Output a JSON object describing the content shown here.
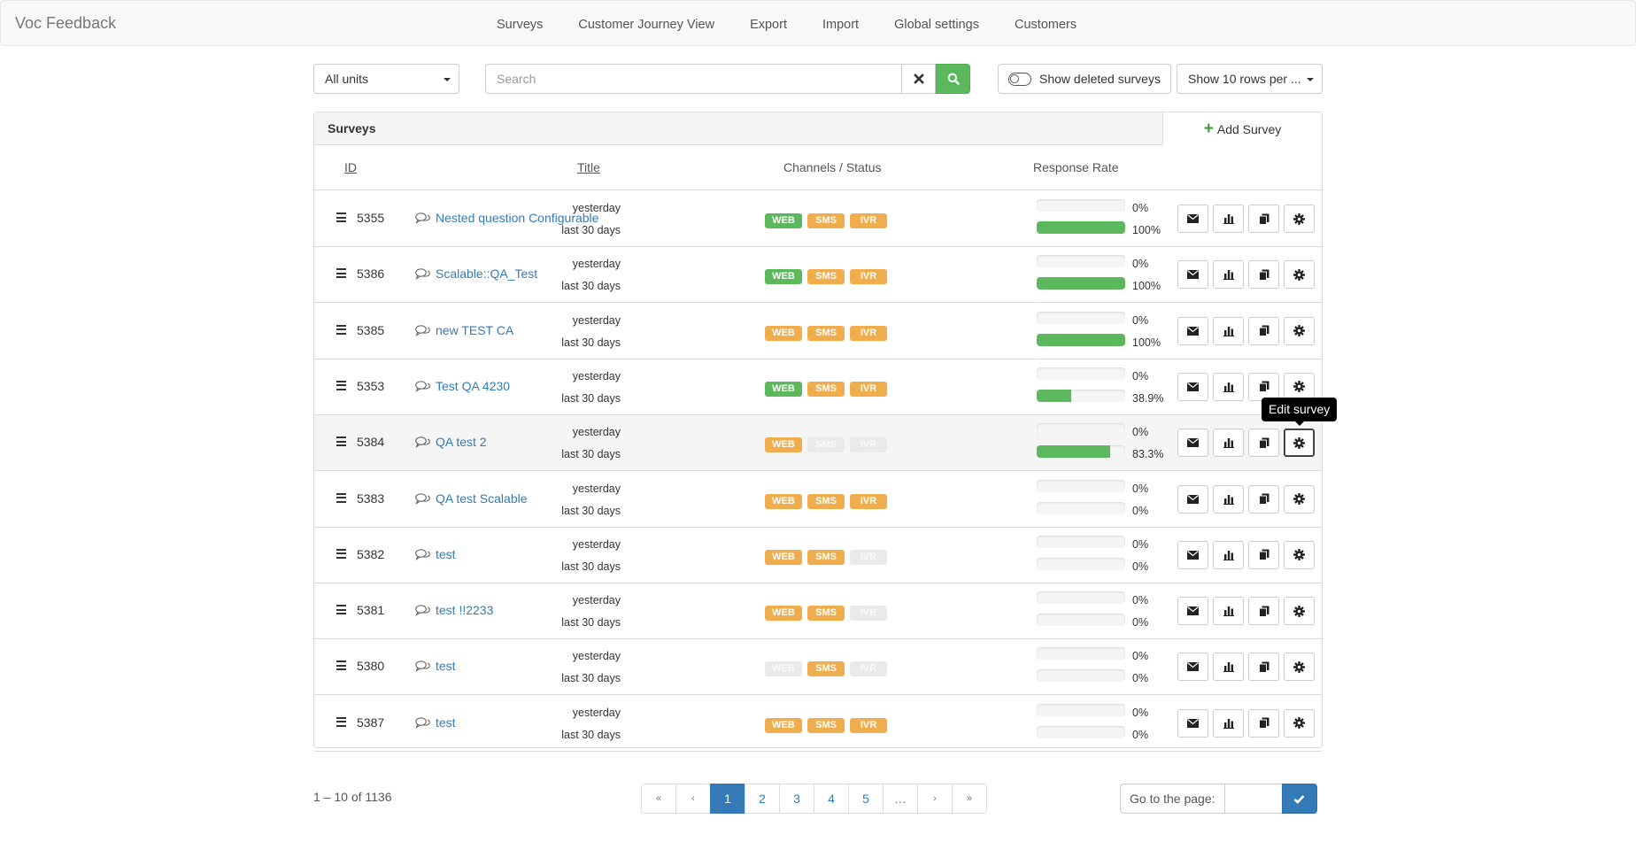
{
  "navbar": {
    "brand": "Voc Feedback",
    "links": [
      "Surveys",
      "Customer Journey View",
      "Export",
      "Import",
      "Global settings",
      "Customers"
    ]
  },
  "toolbar": {
    "units_value": "All units",
    "search_placeholder": "Search",
    "show_deleted_label": "Show deleted surveys",
    "show_deleted_on": false,
    "rows_per_page_label": "Show 10 rows per ..."
  },
  "panel": {
    "title": "Surveys",
    "add_label": "Add Survey",
    "columns": {
      "id": "ID",
      "title": "Title",
      "channels": "Channels / Status",
      "response": "Response Rate"
    }
  },
  "response_labels": {
    "yesterday": "yesterday",
    "last30": "last 30 days"
  },
  "channel_names": [
    "WEB",
    "SMS",
    "IVR"
  ],
  "colors": {
    "active_web": "#5cb85c",
    "active_channel": "#f0ad4e",
    "inactive": "#eaeaea",
    "progress": "#5cb85c",
    "link": "#337ab7"
  },
  "rows": [
    {
      "id": "5355",
      "title": "Nested question Configurable",
      "channels": [
        "green",
        "orange",
        "orange"
      ],
      "yesterday": "0%",
      "yesterday_value": 0,
      "last30": "100%",
      "last30_value": 100
    },
    {
      "id": "5386",
      "title": "Scalable::QA_Test",
      "channels": [
        "green",
        "orange",
        "orange"
      ],
      "yesterday": "0%",
      "yesterday_value": 0,
      "last30": "100%",
      "last30_value": 100
    },
    {
      "id": "5385",
      "title": "new TEST CA",
      "channels": [
        "orange",
        "orange",
        "orange"
      ],
      "yesterday": "0%",
      "yesterday_value": 0,
      "last30": "100%",
      "last30_value": 100
    },
    {
      "id": "5353",
      "title": "Test QA 4230",
      "channels": [
        "green",
        "orange",
        "orange"
      ],
      "yesterday": "0%",
      "yesterday_value": 0,
      "last30": "38.9%",
      "last30_value": 38.9
    },
    {
      "id": "5384",
      "title": "QA test 2",
      "channels": [
        "orange",
        "gray",
        "gray"
      ],
      "yesterday": "0%",
      "yesterday_value": 0,
      "last30": "83.3%",
      "last30_value": 83.3
    },
    {
      "id": "5383",
      "title": "QA test Scalable",
      "channels": [
        "orange",
        "orange",
        "orange"
      ],
      "yesterday": "0%",
      "yesterday_value": 0,
      "last30": "0%",
      "last30_value": 0
    },
    {
      "id": "5382",
      "title": "test",
      "channels": [
        "orange",
        "orange",
        "gray"
      ],
      "yesterday": "0%",
      "yesterday_value": 0,
      "last30": "0%",
      "last30_value": 0
    },
    {
      "id": "5381",
      "title": "test !!2233",
      "channels": [
        "orange",
        "orange",
        "gray"
      ],
      "yesterday": "0%",
      "yesterday_value": 0,
      "last30": "0%",
      "last30_value": 0
    },
    {
      "id": "5380",
      "title": "test",
      "channels": [
        "gray",
        "orange",
        "gray"
      ],
      "yesterday": "0%",
      "yesterday_value": 0,
      "last30": "0%",
      "last30_value": 0
    },
    {
      "id": "5387",
      "title": "test",
      "channels": [
        "orange",
        "orange",
        "orange"
      ],
      "yesterday": "0%",
      "yesterday_value": 0,
      "last30": "0%",
      "last30_value": 0
    }
  ],
  "row_actions": [
    "envelope-icon",
    "bar-chart-icon",
    "copy-icon",
    "gear-icon"
  ],
  "highlighted_row": 4,
  "tooltip": {
    "text": "Edit survey"
  },
  "footer": {
    "range": "1 – 10 of 1136",
    "pages": [
      "«",
      "‹",
      "1",
      "2",
      "3",
      "4",
      "5",
      "…",
      "›",
      "»"
    ],
    "current_page": "1",
    "goto_label": "Go to the page:",
    "goto_value": ""
  }
}
